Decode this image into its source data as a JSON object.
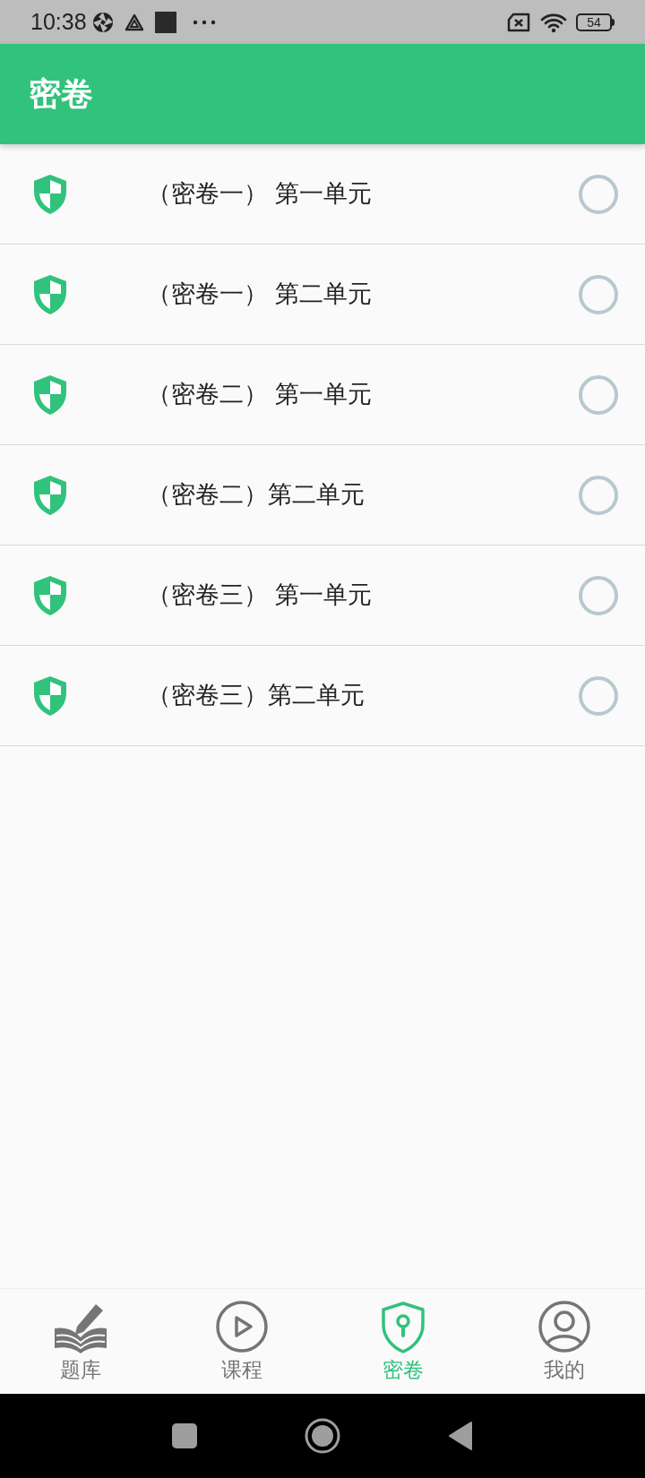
{
  "status_bar": {
    "time": "10:38",
    "battery": "54"
  },
  "app_bar": {
    "title": "密卷"
  },
  "papers": [
    {
      "title": "（密卷一） 第一单元",
      "selected": false
    },
    {
      "title": "（密卷一） 第二单元",
      "selected": false
    },
    {
      "title": "（密卷二） 第一单元",
      "selected": false
    },
    {
      "title": "（密卷二）第二单元",
      "selected": false
    },
    {
      "title": "（密卷三） 第一单元",
      "selected": false
    },
    {
      "title": "（密卷三）第二单元",
      "selected": false
    }
  ],
  "bottom_nav": [
    {
      "kind": "book",
      "label": "题库",
      "selected": false
    },
    {
      "kind": "play",
      "label": "课程",
      "selected": false
    },
    {
      "kind": "shield",
      "label": "密卷",
      "selected": true
    },
    {
      "kind": "person",
      "label": "我的",
      "selected": false
    }
  ]
}
